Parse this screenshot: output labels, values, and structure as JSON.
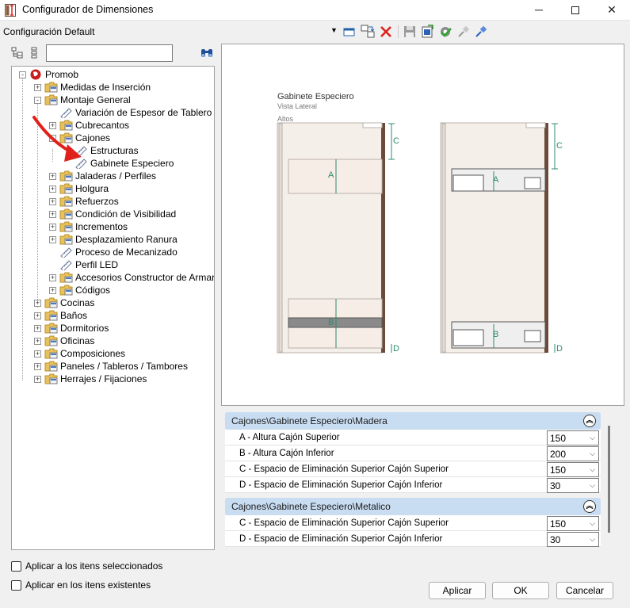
{
  "window": {
    "title": "Configurador de Dimensiones",
    "minimize_glyph": "─",
    "close_glyph": "✕"
  },
  "config": {
    "label": "Configuración Default",
    "dropdown_glyph": "▼"
  },
  "toolbar_icons": [
    "window-icon",
    "transfer-icon",
    "delete-icon",
    "save-icon",
    "export-icon",
    "check-gear-icon",
    "pin-icon",
    "edit-pin-icon"
  ],
  "search": {
    "value": "",
    "placeholder": ""
  },
  "tree": {
    "root": "Promob",
    "items": [
      {
        "label": "Medidas de Inserción"
      },
      {
        "label": "Montaje General"
      },
      {
        "label": "Variación de Espesor de Tablero"
      },
      {
        "label": "Cubrecantos"
      },
      {
        "label": "Cajones"
      },
      {
        "label": "Estructuras"
      },
      {
        "label": "Gabinete Especiero"
      },
      {
        "label": "Jaladeras / Perfiles"
      },
      {
        "label": "Holgura"
      },
      {
        "label": "Refuerzos"
      },
      {
        "label": "Condición de Visibilidad"
      },
      {
        "label": "Incrementos"
      },
      {
        "label": "Desplazamiento Ranura"
      },
      {
        "label": "Proceso de Mecanizado"
      },
      {
        "label": "Perfil LED"
      },
      {
        "label": "Accesorios Constructor de Armarios"
      },
      {
        "label": "Códigos"
      },
      {
        "label": "Cocinas"
      },
      {
        "label": "Baños"
      },
      {
        "label": "Dormitorios"
      },
      {
        "label": "Oficinas"
      },
      {
        "label": "Composiciones"
      },
      {
        "label": "Paneles / Tableros / Tambores"
      },
      {
        "label": "Herrajes / Fijaciones"
      }
    ]
  },
  "preview": {
    "title": "Gabinete Especiero",
    "subtitle": "Vista Lateral",
    "section": "Altos",
    "labels": {
      "a": "A",
      "b": "B",
      "c": "C",
      "d": "D",
      "a2": "A",
      "b2": "B",
      "c2": "C",
      "d2": "D"
    }
  },
  "groups": [
    {
      "title": "Cajones\\Gabinete Especiero\\Madera",
      "rows": [
        {
          "label": "A - Altura Cajón Superior",
          "value": "150"
        },
        {
          "label": "B - Altura Cajón Inferior",
          "value": "200"
        },
        {
          "label": "C - Espacio de Eliminación Superior Cajón Superior",
          "value": "150"
        },
        {
          "label": "D - Espacio de Eliminación Superior Cajón Inferior",
          "value": "30"
        }
      ]
    },
    {
      "title": "Cajones\\Gabinete Especiero\\Metalico",
      "rows": [
        {
          "label": "C - Espacio de Eliminación Superior Cajón Superior",
          "value": "150"
        },
        {
          "label": "D - Espacio de Eliminación Superior Cajón Inferior",
          "value": "30"
        }
      ]
    }
  ],
  "collapse_glyph": "︽",
  "chevron_glyph": "⌵",
  "checkboxes": [
    {
      "label": "Aplicar a los itens seleccionados",
      "checked": false
    },
    {
      "label": "Aplicar en los itens existentes",
      "checked": false
    }
  ],
  "buttons": {
    "apply": "Aplicar",
    "ok": "OK",
    "cancel": "Cancelar"
  },
  "colors": {
    "accent_header": "#c9ddf2",
    "arrow": "#e0201b",
    "dimension": "#2e8b6e",
    "panel": "#f5efea",
    "side_panel": "#6b4a3a"
  }
}
